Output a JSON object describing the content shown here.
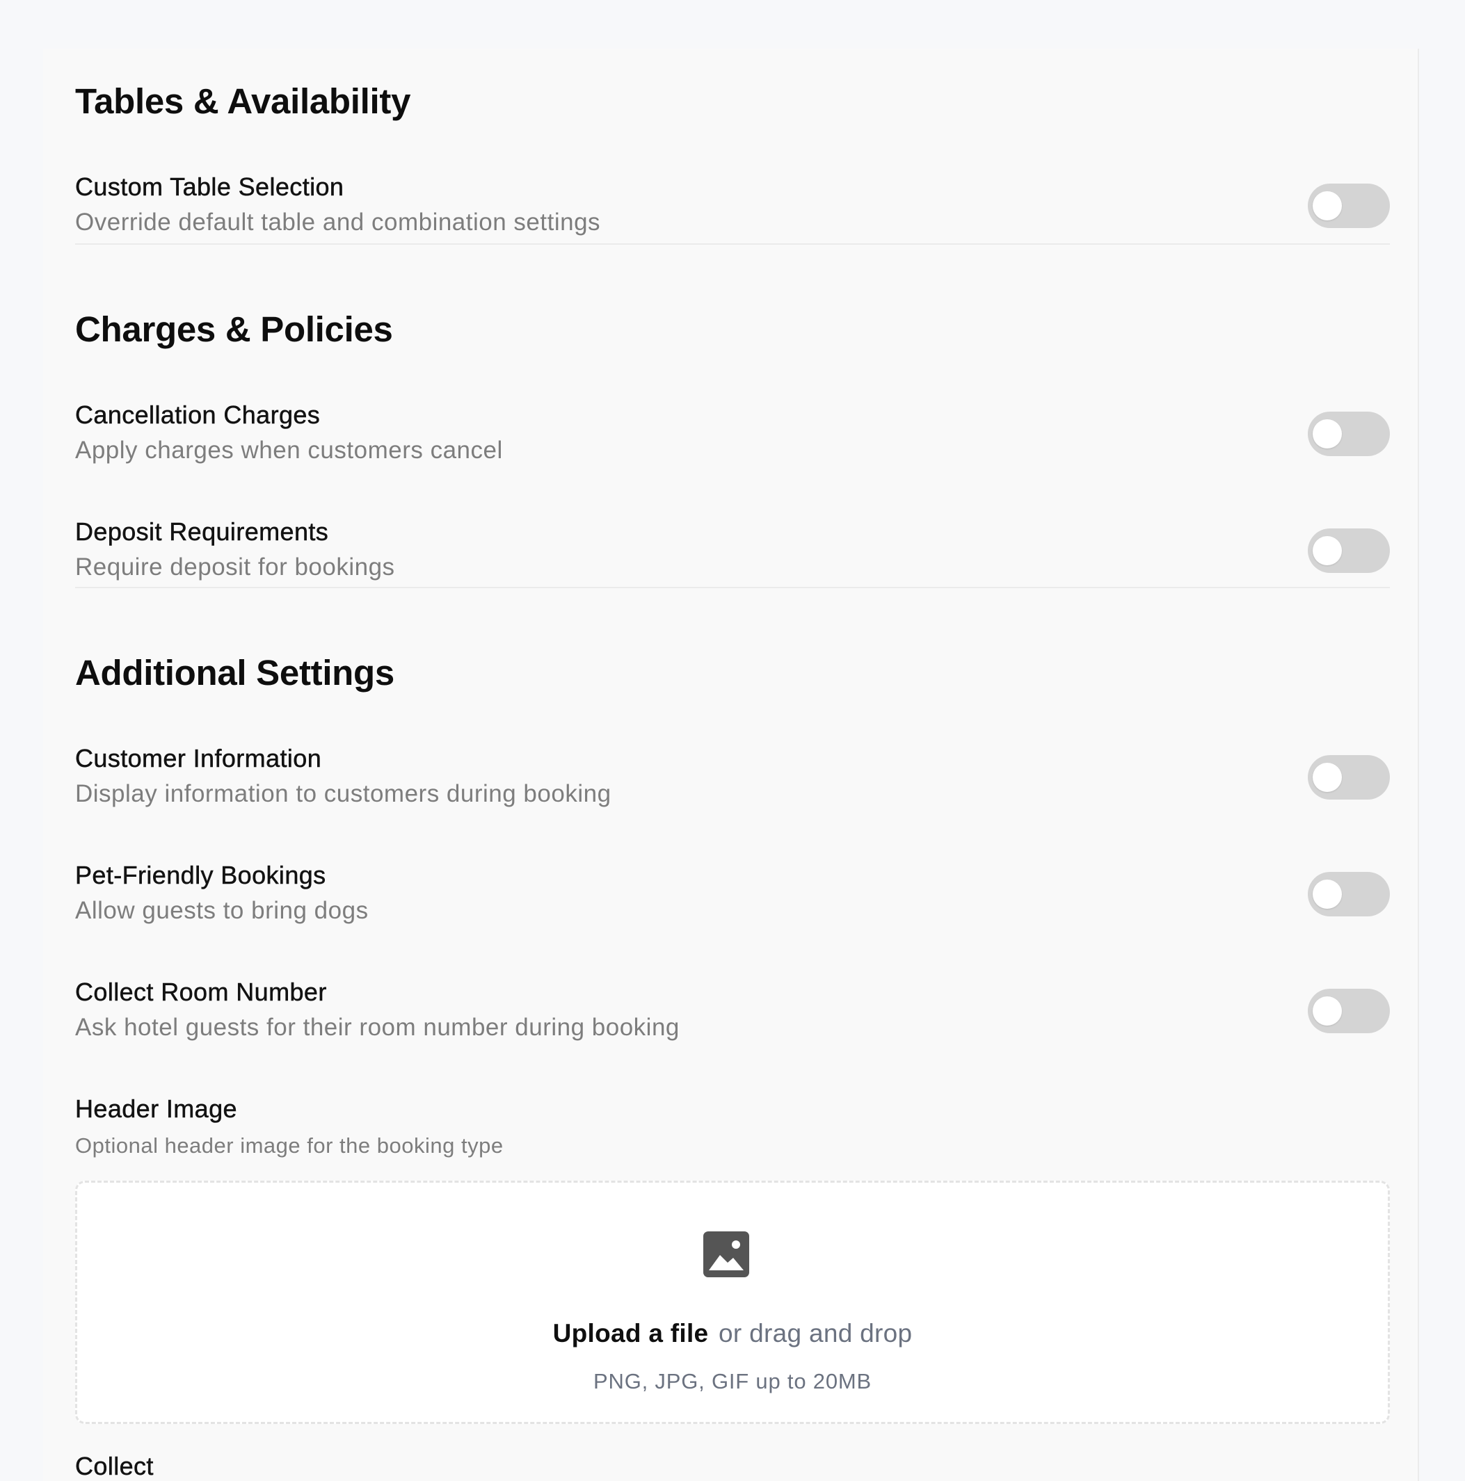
{
  "sections": [
    {
      "title": "Tables & Availability",
      "rows": [
        {
          "label": "Custom Table Selection",
          "description": "Override default table and combination settings",
          "enabled": false
        }
      ]
    },
    {
      "title": "Charges & Policies",
      "rows": [
        {
          "label": "Cancellation Charges",
          "description": "Apply charges when customers cancel",
          "enabled": false
        },
        {
          "label": "Deposit Requirements",
          "description": "Require deposit for bookings",
          "enabled": false
        }
      ]
    },
    {
      "title": "Additional Settings",
      "rows": [
        {
          "label": "Customer Information",
          "description": "Display information to customers during booking",
          "enabled": false
        },
        {
          "label": "Pet-Friendly Bookings",
          "description": "Allow guests to bring dogs",
          "enabled": false
        },
        {
          "label": "Collect Room Number",
          "description": "Ask hotel guests for their room number during booking",
          "enabled": false
        }
      ]
    }
  ],
  "header_image": {
    "label": "Header Image",
    "description": "Optional header image for the booking type",
    "icon": "image-icon",
    "upload_link": "Upload a file",
    "upload_rest": "or drag and drop",
    "hint": "PNG, JPG, GIF up to 20MB"
  },
  "next_field_label_partial": "Collect"
}
